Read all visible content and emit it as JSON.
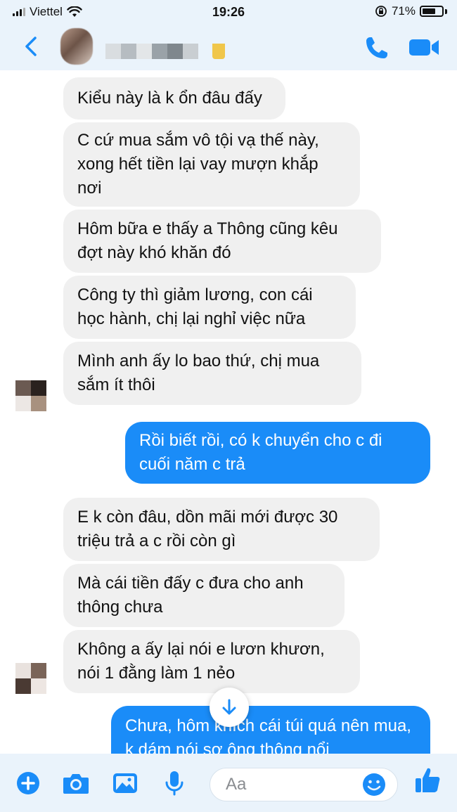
{
  "status_bar": {
    "carrier": "Viettel",
    "time": "19:26",
    "battery": "71%",
    "battery_level": 0.71
  },
  "header": {
    "contact_name": ""
  },
  "messages": [
    {
      "side": "in",
      "text": "Kiểu này là k ổn đâu đấy"
    },
    {
      "side": "in",
      "text": "C cứ mua sắm vô tội vạ thế này, xong hết tiền lại vay mượn khắp nơi"
    },
    {
      "side": "in",
      "text": "Hôm bữa e thấy a Thông cũng kêu đợt này khó khăn đó"
    },
    {
      "side": "in",
      "text": "Công ty thì giảm lương, con cái học hành, chị lại nghỉ việc nữa"
    },
    {
      "side": "in",
      "text": "Mình anh ấy lo bao thứ, chị mua sắm ít thôi"
    },
    {
      "side": "out",
      "text": "Rồi biết rồi, có k chuyển cho c đi cuối năm c trả"
    },
    {
      "side": "in",
      "text": "E k còn đâu, dồn mãi mới được 30 triệu trả a c rồi còn gì"
    },
    {
      "side": "in",
      "text": "Mà cái tiền đấy c đưa cho anh thông chưa"
    },
    {
      "side": "in",
      "text": "Không a ấy lại nói e lươn khươn, nói 1 đằng làm 1 nẻo"
    },
    {
      "side": "out",
      "text": "Chưa, hôm khích cái túi quá nên mua, k dám nói sợ ông thông nổi"
    }
  ],
  "composer": {
    "placeholder": "Aa"
  },
  "icons": {
    "back": "chevron-left-icon",
    "call": "phone-icon",
    "video": "video-camera-icon",
    "scroll": "arrow-down-icon",
    "add": "plus-circle-icon",
    "camera": "camera-icon",
    "photo": "photo-icon",
    "mic": "microphone-icon",
    "emoji": "emoji-icon",
    "like": "thumbs-up-icon"
  },
  "colors": {
    "accent": "#1a8cf8",
    "incoming_bubble": "#f0f0f0",
    "header_bg": "#eaf3fb"
  }
}
